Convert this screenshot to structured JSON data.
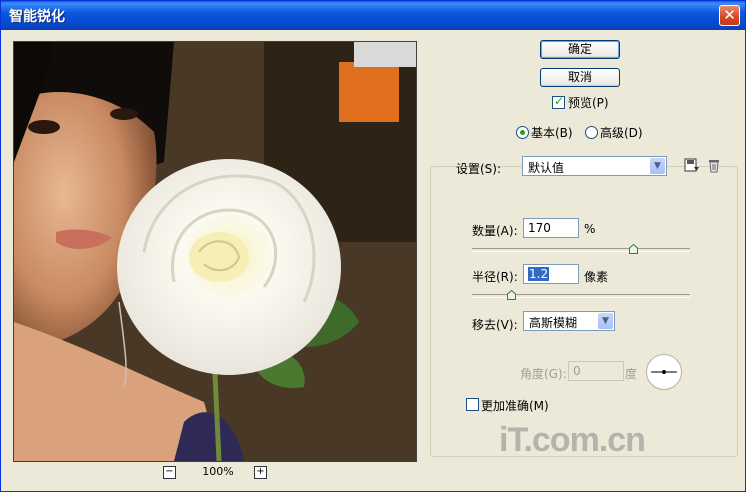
{
  "window": {
    "title": "智能锐化",
    "close_label": "✕"
  },
  "preview": {
    "zoom_out_label": "−",
    "zoom_level": "100%",
    "zoom_in_label": "+"
  },
  "buttons": {
    "ok": "确定",
    "cancel": "取消"
  },
  "preview_checkbox": {
    "label": "预览(P)",
    "checked": true
  },
  "mode": {
    "basic": "基本(B)",
    "advanced": "高级(D)",
    "selected": "basic"
  },
  "settings": {
    "label": "设置(S):",
    "value": "默认值",
    "save_icon": "save-settings-icon",
    "delete_icon": "trash-icon"
  },
  "amount": {
    "label": "数量(A):",
    "value": "170",
    "unit": "%",
    "slider_fraction": 0.74
  },
  "radius": {
    "label": "半径(R):",
    "value": "1.2",
    "unit": "像素",
    "slider_fraction": 0.18
  },
  "remove": {
    "label": "移去(V):",
    "value": "高斯模糊"
  },
  "angle": {
    "label": "角度(G):",
    "value": "0",
    "unit": "度"
  },
  "more_accurate": {
    "label": "更加准确(M)",
    "checked": false
  },
  "watermark": "iT.com.cn"
}
